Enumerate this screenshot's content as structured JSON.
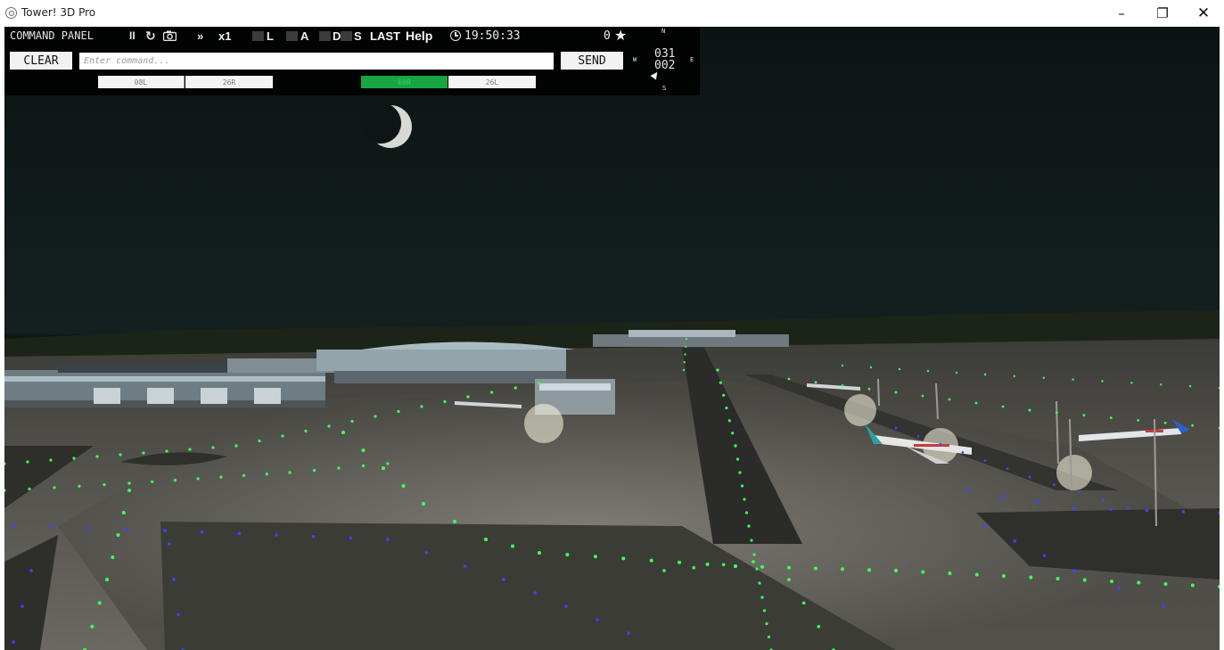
{
  "window": {
    "title": "Tower! 3D Pro",
    "minimize": "–",
    "maximize": "❐",
    "close": "✕"
  },
  "panel": {
    "title": "COMMAND PANEL",
    "pause": "II",
    "refresh": "↻",
    "fast_forward": "»",
    "speed": "x1",
    "toggles": {
      "l": "L",
      "a": "A",
      "d": "D",
      "s": "S"
    },
    "last": "LAST",
    "help": "Help",
    "clock": "19:50:33",
    "score": "0",
    "star": "★"
  },
  "command": {
    "clear_label": "CLEAR",
    "placeholder": "Enter command...",
    "value": "",
    "send_label": "SEND"
  },
  "runways": [
    {
      "label": "08L",
      "active": false
    },
    {
      "label": "26R",
      "active": false
    },
    {
      "label": "08R",
      "active": true
    },
    {
      "label": "26L",
      "active": false
    }
  ],
  "compass": {
    "n": "N",
    "e": "E",
    "s": "S",
    "w": "W",
    "heading": "031",
    "bearing": "002"
  },
  "colors": {
    "sky": "#0e1716",
    "active_runway": "#19a542",
    "taxi_light_green": "#3cff5a",
    "edge_light_blue": "#3b45ff"
  }
}
